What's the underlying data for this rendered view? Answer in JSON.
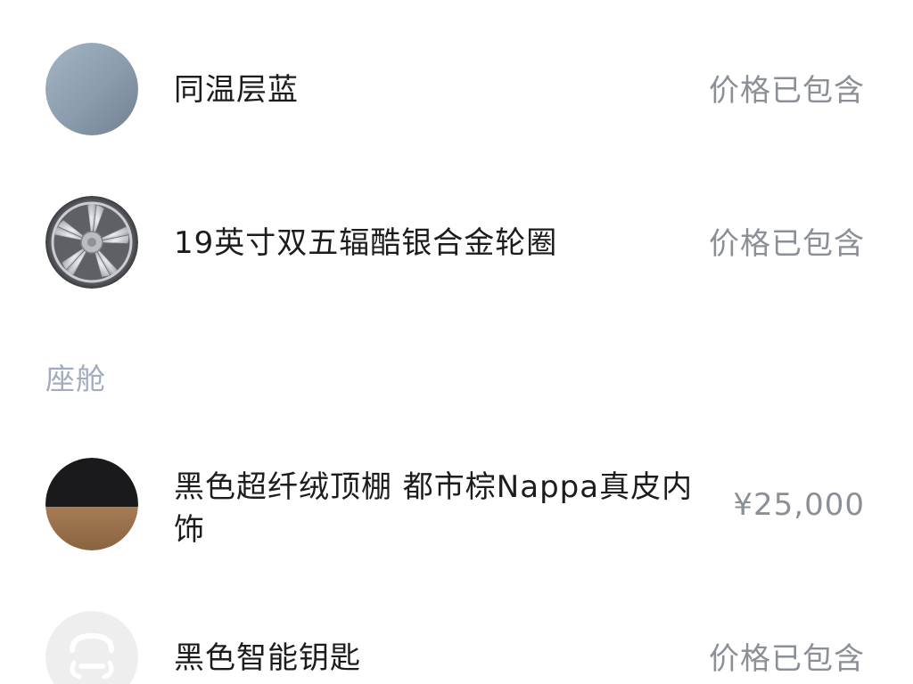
{
  "options": [
    {
      "name": "同温层蓝",
      "price": "价格已包含",
      "icon": "color-swatch-icon",
      "swatch_color": "#8c9eaf"
    },
    {
      "name": "19英寸双五辐酷银合金轮圈",
      "price": "价格已包含",
      "icon": "alloy-wheel-icon"
    }
  ],
  "cabin": {
    "section_title": "座舱",
    "options": [
      {
        "name_line1": "黑色超纤绒顶棚 都市棕Nappa真皮内",
        "name_line2": "饰",
        "price": "¥25,000",
        "icon": "interior-swatch-icon",
        "colors": [
          "#1a1a1c",
          "#9b7350"
        ]
      },
      {
        "name": "黑色智能钥匙",
        "price": "价格已包含",
        "icon": "smart-key-icon"
      }
    ]
  }
}
